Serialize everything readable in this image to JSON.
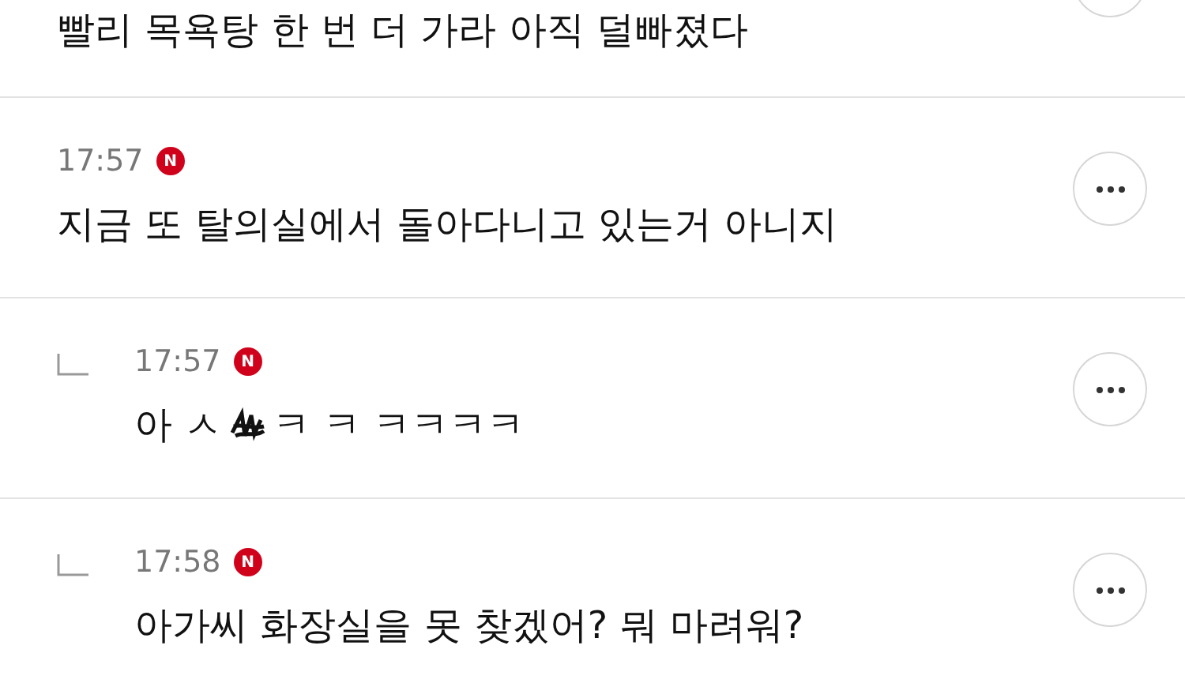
{
  "top_comment": {
    "text": "빨리 목욕탕 한 번 더 가라 아직 덜빠졌다"
  },
  "comments": [
    {
      "reply": false,
      "time": "17:57",
      "badge": "N",
      "kind": "plain",
      "text": "지금 또 탈의실에서 돌아다니고 있는거 아니지"
    },
    {
      "reply": true,
      "time": "17:57",
      "badge": "N",
      "kind": "scribbled",
      "text_before": "아 ㅅ",
      "text_after": "ㅋ ㅋ ㅋㅋㅋㅋ"
    },
    {
      "reply": true,
      "time": "17:58",
      "badge": "N",
      "kind": "plain",
      "text": "아가씨 화장실을 못 찾겠어? 뭐 마려워?"
    }
  ]
}
